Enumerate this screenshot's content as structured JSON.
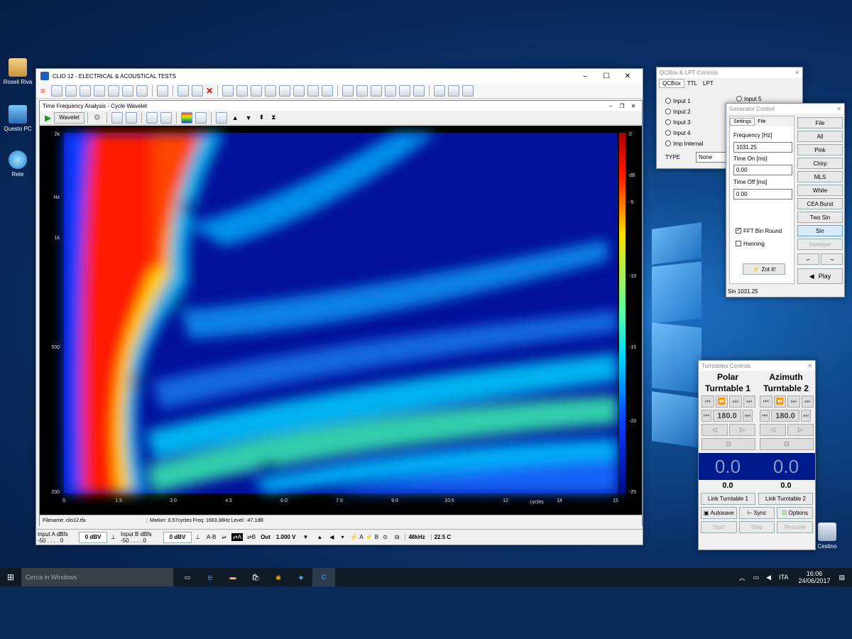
{
  "desktop": {
    "icons": [
      {
        "label": "Roseli Riva"
      },
      {
        "label": "Questo PC"
      },
      {
        "label": "Rete"
      },
      {
        "label": "Cestino"
      }
    ]
  },
  "clio": {
    "title": "CLIO 12 - ELECTRICAL & ACOUSTICAL TESTS",
    "tfa": {
      "title": "Time Frequency Analysis - Cycle Wavelet",
      "mode": "Wavelet",
      "y_ticks": [
        "2k",
        "Hz",
        "1k",
        "500",
        "200"
      ],
      "x_ticks": [
        "0",
        "1.5",
        "3.0",
        "4.5",
        "6.0",
        "7.5",
        "9.0",
        "10.5",
        "12",
        "14",
        "15"
      ],
      "x_unit": "cycles",
      "cbar_ticks": [
        "0",
        "dB",
        "-5",
        "-10",
        "-15",
        "-20",
        "-25"
      ],
      "filename": "Filename: clio12.tfa",
      "marker": "Marker: 0.57cycles  Freq: 1683.38Hz  Level: -47.1dB"
    },
    "status": {
      "inputA": "Input A",
      "dbfs": "dBfs",
      "scaleA": "-50 . . . . 0",
      "dbvA": "0 dBV",
      "inputB": "Input B",
      "scaleB": "-50 . . . . 0",
      "dbvB": "0 dBV",
      "ab": "A-B",
      "out": "Out",
      "outv": "1.000 V",
      "a": "A",
      "b": "B",
      "rate": "48kHz",
      "temp": "22.5 C"
    }
  },
  "qcbox": {
    "title": "QCBox & LPT Controls",
    "tabs": [
      "QCBox",
      "TTL",
      "LPT"
    ],
    "inputs": [
      "Input 1",
      "Input 2",
      "Input 3",
      "Input 4",
      "Imp Internal"
    ],
    "input5": "Input 5",
    "type_label": "TYPE",
    "type_value": "None"
  },
  "generator": {
    "title": "Generator Control",
    "tabs": [
      "Settings",
      "File"
    ],
    "freq_label": "Frequency [Hz]",
    "freq": "1031.25",
    "ton_label": "Time On [ms]",
    "ton": "0.00",
    "toff_label": "Time Off [ms]",
    "toff": "0.00",
    "fft": "FFT Bin Round",
    "hanning": "Hanning",
    "zot": "Zot it!",
    "status": "Sin 1031.25",
    "signals": [
      "File",
      "All",
      "Pink",
      "Chirp",
      "MLS",
      "White",
      "CEA Burst",
      "Two Sin",
      "Sin",
      "Sweeper"
    ],
    "play": "Play"
  },
  "turntables": {
    "title": "Turntables Controls",
    "polar": "Polar",
    "azimuth": "Azimuth",
    "tt1": "Turntable 1",
    "tt2": "Turntable 2",
    "angle1": "180.0",
    "angle2": "180.0",
    "big1": "0.0",
    "big2": "0.0",
    "small1": "0.0",
    "small2": "0.0",
    "link1": "Link Turntable 1",
    "link2": "Link Turntable 2",
    "autosave": "Autosave",
    "sync": "Sync",
    "options": "Options",
    "start": "Start",
    "stop": "Stop",
    "resume": "Resume"
  },
  "taskbar": {
    "search": "Cerca in Windows",
    "lang": "ITA",
    "time": "16:06",
    "date": "24/06/2017"
  }
}
